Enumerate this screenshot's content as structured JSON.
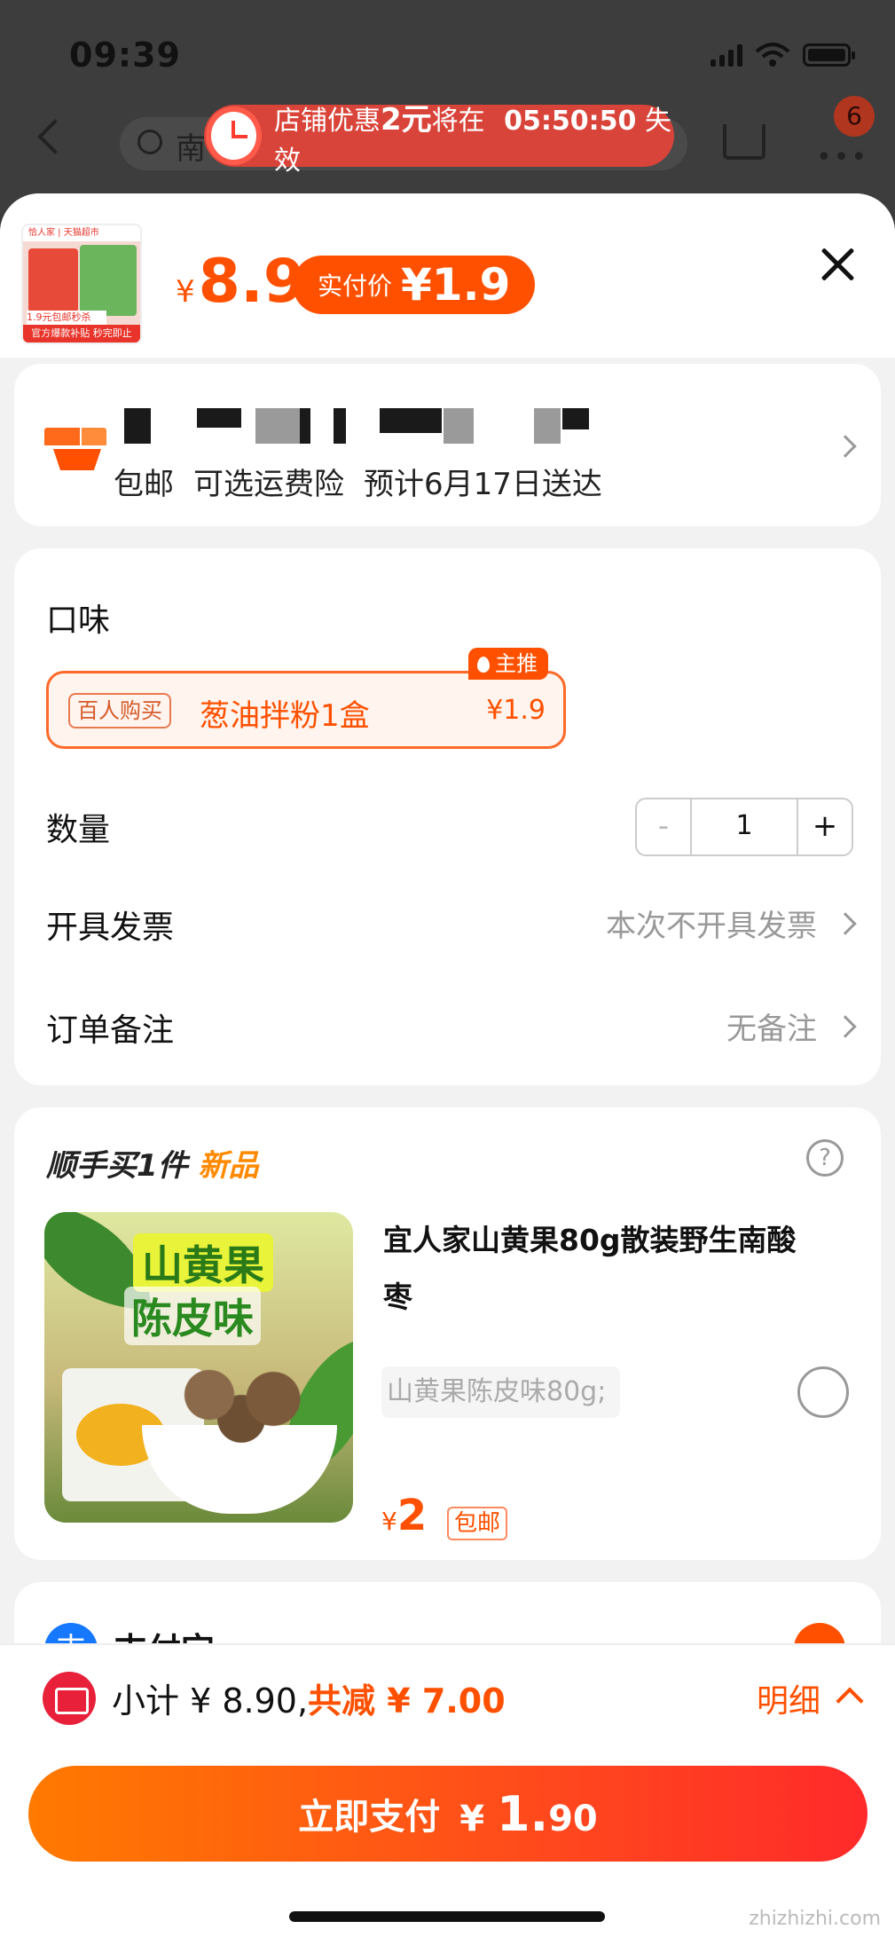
{
  "status_bar": {
    "time": "09:39"
  },
  "nav": {
    "search_text": "南",
    "cart_badge": "6"
  },
  "promo": {
    "prefix": "店铺优惠",
    "amount": "2元",
    "middle": "将在",
    "countdown": "05:50:50",
    "suffix": "失效"
  },
  "header": {
    "currency": "¥",
    "price": "8.9",
    "pay_label": "实付价",
    "pay_price": "¥1.9",
    "thumb_top": "恰人家 | 天猫超市",
    "thumb_mid": "1.9元包邮秒杀",
    "thumb_bottom": "官方爆款补贴 秒完即止"
  },
  "address": {
    "shipping": "包邮",
    "insurance": "可选运费险",
    "eta": "预计6月17日送达"
  },
  "options": {
    "flavor_label": "口味",
    "flavor_tag": "百人购买",
    "flavor_name": "葱油拌粉1盒",
    "flavor_price": "¥1.9",
    "main_tag": "主推",
    "qty_label": "数量",
    "qty_minus": "-",
    "qty_value": "1",
    "qty_plus": "+",
    "invoice_label": "开具发票",
    "invoice_value": "本次不开具发票",
    "note_label": "订单备注",
    "note_value": "无备注"
  },
  "extra": {
    "title": "顺手买1件",
    "title_tag": "新品",
    "help": "?",
    "img_text1": "山黄果",
    "img_text2": "陈皮味",
    "product_name": "宜人家山黄果80g散装野生南酸枣",
    "spec": "山黄果陈皮味80g;",
    "currency": "¥",
    "price": "2",
    "badge": "包邮"
  },
  "payment": {
    "icon": "支",
    "label": "支付宝"
  },
  "footer": {
    "subtotal": "小计 ¥ 8.90,",
    "discount": "共减 ¥ 7.00",
    "detail": "明细",
    "pay_label": "立即支付",
    "pay_currency": "¥",
    "pay_int": "1.",
    "pay_dec": "90"
  },
  "watermark": "zhizhizhi.com",
  "colors": {
    "accent": "#ff5000",
    "new_tag": "#ff8a00",
    "alipay": "#1677ff"
  }
}
